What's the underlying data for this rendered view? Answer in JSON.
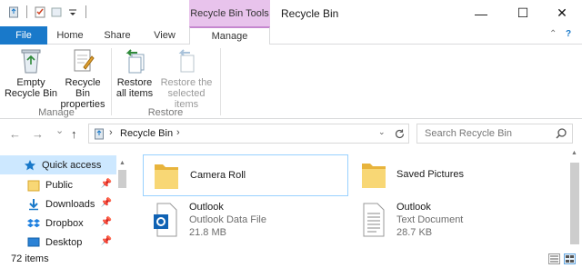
{
  "window": {
    "title": "Recycle Bin",
    "contextual_tab": "Recycle Bin Tools",
    "minimize_glyph": "—",
    "maximize_glyph": "☐",
    "close_glyph": "✕"
  },
  "ribbon_tabs": {
    "file": "File",
    "home": "Home",
    "share": "Share",
    "view": "View",
    "manage": "Manage",
    "collapse_glyph": "⌃",
    "help_glyph": "?"
  },
  "ribbon": {
    "empty_bin_line1": "Empty",
    "empty_bin_line2": "Recycle Bin",
    "properties_line1": "Recycle Bin",
    "properties_line2": "properties",
    "manage_group": "Manage",
    "restore_all_line1": "Restore",
    "restore_all_line2": "all items",
    "restore_selected_line1": "Restore the",
    "restore_selected_line2": "selected items",
    "restore_group": "Restore"
  },
  "address": {
    "path": "Recycle Bin",
    "separator": "›",
    "search_placeholder": "Search Recycle Bin"
  },
  "nav": {
    "back": "←",
    "forward": "→",
    "recent": "⌄",
    "up": "↑",
    "items": [
      {
        "label": "Quick access"
      },
      {
        "label": "Public"
      },
      {
        "label": "Downloads"
      },
      {
        "label": "Dropbox"
      },
      {
        "label": "Desktop"
      }
    ]
  },
  "files": [
    {
      "name": "Camera Roll",
      "icon": "folder-icon"
    },
    {
      "name": "Saved Pictures",
      "icon": "folder-icon"
    },
    {
      "name": "Outlook",
      "type": "Outlook Data File",
      "size": "21.8 MB",
      "icon": "outlook-file-icon"
    },
    {
      "name": "Outlook",
      "type": "Text Document",
      "size": "28.7 KB",
      "icon": "text-document-icon"
    }
  ],
  "status": {
    "item_count": "72 items"
  },
  "colors": {
    "accent": "#1979ca",
    "contextual": "#e8c3ec",
    "selection": "#cde8ff",
    "folder": "#f8d775"
  }
}
